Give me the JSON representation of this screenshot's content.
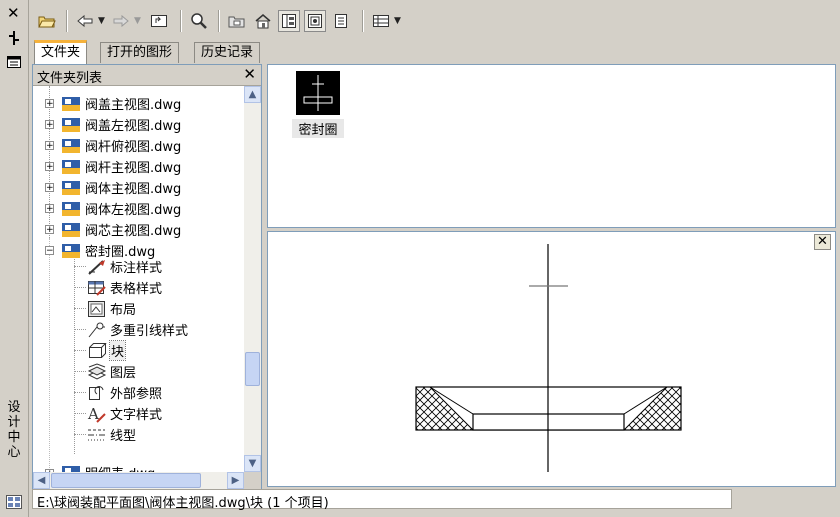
{
  "window": {
    "title_vertical": "设计中心"
  },
  "tabs": [
    {
      "label": "文件夹",
      "active": true
    },
    {
      "label": "打开的图形",
      "active": false
    },
    {
      "label": "历史记录",
      "active": false
    }
  ],
  "toolbar": {
    "buttons": [
      "load-icon",
      "back-icon",
      "forward-icon",
      "up-icon",
      "search-icon",
      "favorites-icon",
      "home-icon",
      "tree-toggle-icon",
      "preview-icon",
      "description-icon",
      "views-icon"
    ]
  },
  "tree": {
    "header": "文件夹列表",
    "items": [
      {
        "label": "阀盖主视图.dwg",
        "expanded": false
      },
      {
        "label": "阀盖左视图.dwg",
        "expanded": false
      },
      {
        "label": "阀杆俯视图.dwg",
        "expanded": false
      },
      {
        "label": "阀杆主视图.dwg",
        "expanded": false
      },
      {
        "label": "阀体主视图.dwg",
        "expanded": false
      },
      {
        "label": "阀体左视图.dwg",
        "expanded": false
      },
      {
        "label": "阀芯主视图.dwg",
        "expanded": false
      },
      {
        "label": "密封圈.dwg",
        "expanded": true
      }
    ],
    "children": [
      {
        "label": "标注样式",
        "icon": "dimension-style-icon"
      },
      {
        "label": "表格样式",
        "icon": "table-style-icon"
      },
      {
        "label": "布局",
        "icon": "layout-icon"
      },
      {
        "label": "多重引线样式",
        "icon": "multileader-style-icon"
      },
      {
        "label": "块",
        "icon": "block-icon",
        "selected": true
      },
      {
        "label": "图层",
        "icon": "layer-icon"
      },
      {
        "label": "外部参照",
        "icon": "xref-icon"
      },
      {
        "label": "文字样式",
        "icon": "text-style-icon"
      },
      {
        "label": "线型",
        "icon": "linetype-icon"
      }
    ],
    "partial_item": "明细表.dwg"
  },
  "content": {
    "items": [
      {
        "label": "密封圈"
      }
    ]
  },
  "status": {
    "path": "E:\\球阀装配平面图\\阀体主视图.dwg\\块 (1 个项目)"
  }
}
